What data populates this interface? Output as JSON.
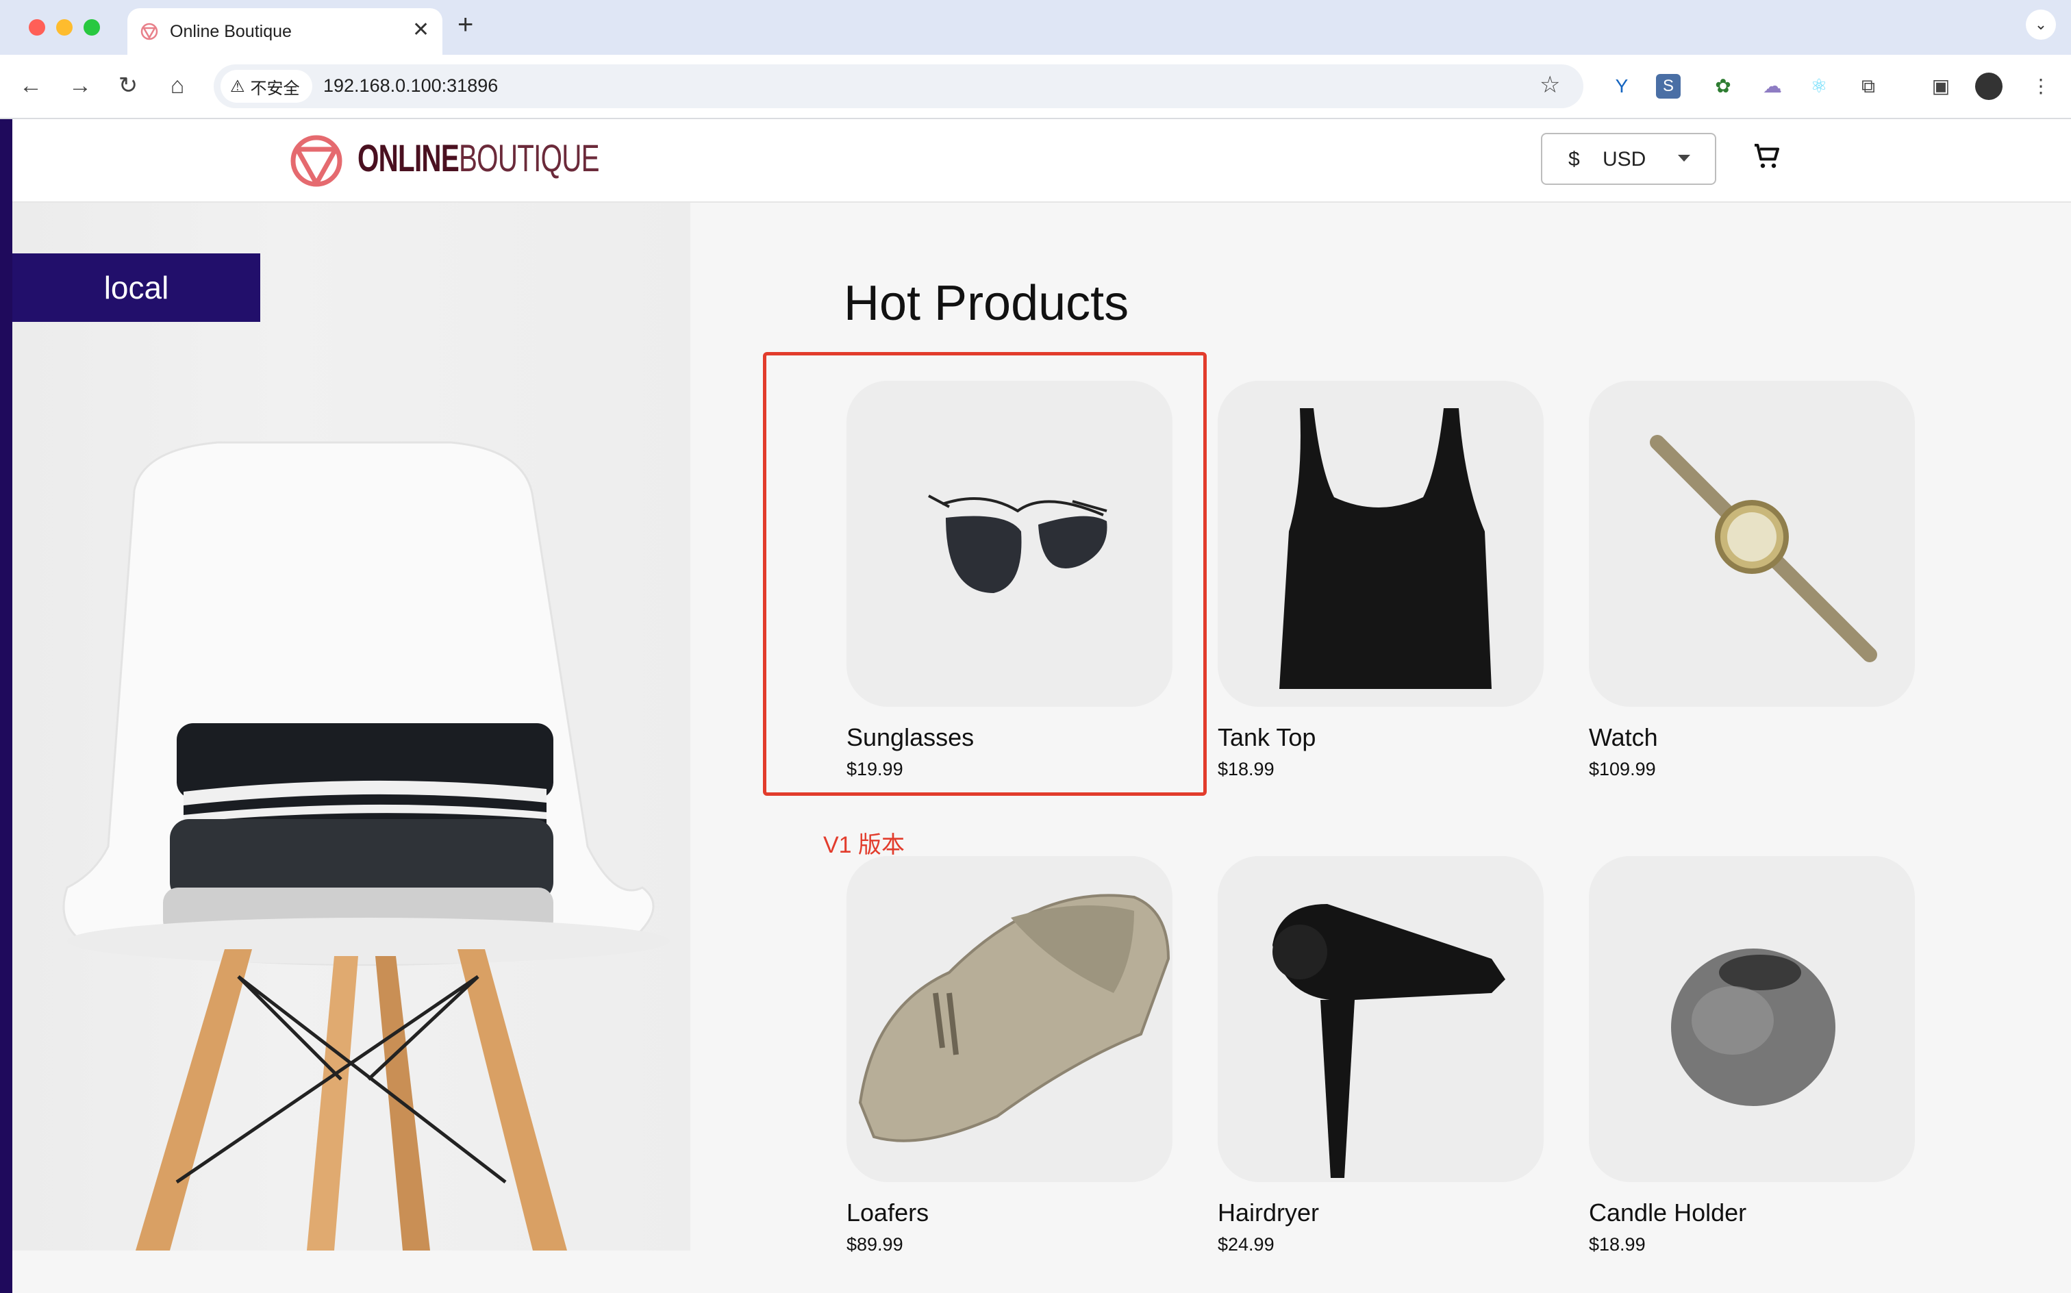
{
  "browser": {
    "tab_title": "Online Boutique",
    "new_tab_symbol": "+",
    "close_symbol": "✕",
    "security_label": "不安全",
    "url": "192.168.0.100:31896"
  },
  "site": {
    "logo_part1": "ONLINE",
    "logo_part2": "BOUTIQUE",
    "currency_symbol": "$",
    "currency_value": "USD",
    "hero_badge": "local",
    "section_title": "Hot Products"
  },
  "products": [
    {
      "name": "Sunglasses",
      "price": "$19.99",
      "icon": "sunglasses"
    },
    {
      "name": "Tank Top",
      "price": "$18.99",
      "icon": "tank-top"
    },
    {
      "name": "Watch",
      "price": "$109.99",
      "icon": "watch"
    },
    {
      "name": "Loafers",
      "price": "$89.99",
      "icon": "loafers"
    },
    {
      "name": "Hairdryer",
      "price": "$24.99",
      "icon": "hairdryer"
    },
    {
      "name": "Candle Holder",
      "price": "$18.99",
      "icon": "candle-holder"
    }
  ],
  "annotation": {
    "label": "V1 版本",
    "color": "#e23c2c"
  },
  "colors": {
    "brand_dark": "#220f6b",
    "logo": "#4a1020",
    "highlight": "#e23c2c"
  }
}
